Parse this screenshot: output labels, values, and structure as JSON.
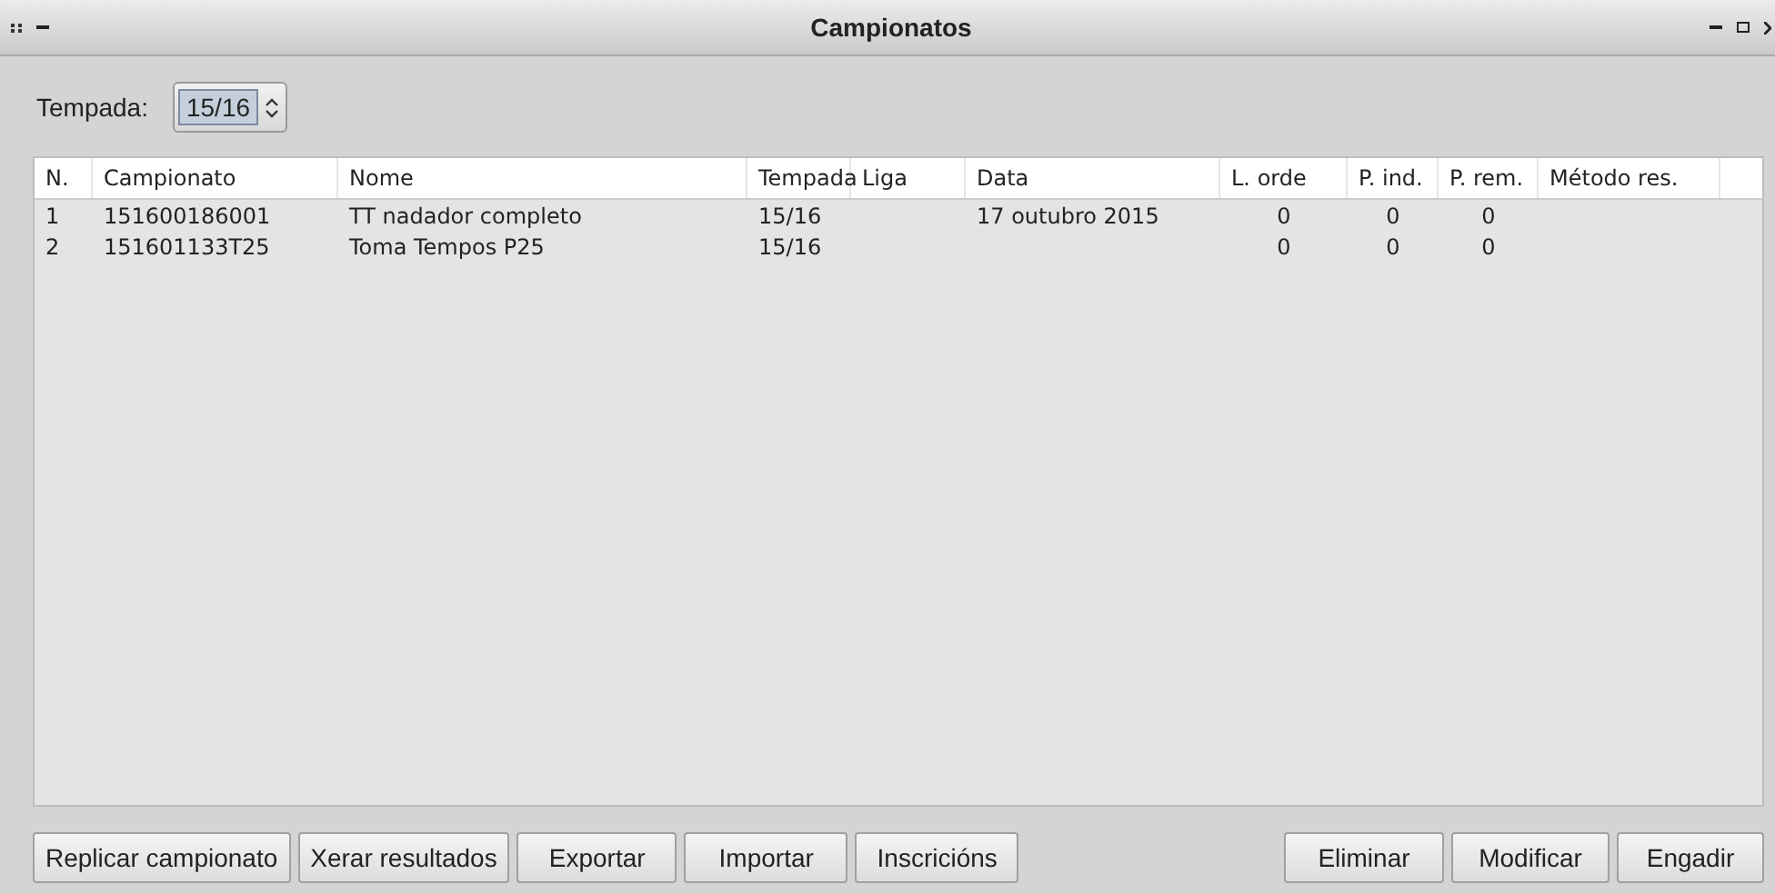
{
  "window": {
    "title": "Campionatos"
  },
  "season": {
    "label": "Tempada:",
    "value": "15/16"
  },
  "table": {
    "columns": [
      "N.",
      "Campionato",
      "Nome",
      "Tempada",
      "Liga",
      "Data",
      "L. orde",
      "P. ind.",
      "P. rem.",
      "Método res."
    ],
    "rows": [
      [
        "1",
        "151600186001",
        "TT nadador completo",
        "15/16",
        "",
        "17 outubro 2015",
        "0",
        "0",
        "0",
        ""
      ],
      [
        "2",
        "151601133T25",
        "Toma Tempos P25",
        "15/16",
        "",
        "",
        "0",
        "0",
        "0",
        ""
      ]
    ]
  },
  "left_buttons": [
    "Replicar campionato",
    "Xerar resultados",
    "Exportar",
    "Importar",
    "Inscricións"
  ],
  "right_buttons": [
    "Eliminar",
    "Modificar",
    "Engadir"
  ]
}
